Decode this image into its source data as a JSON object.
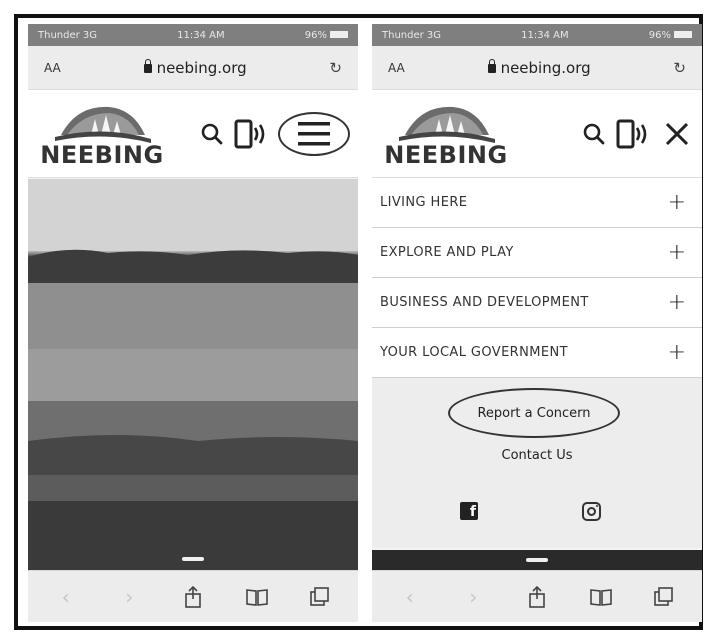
{
  "left_phone": {
    "status": {
      "carrier": "Thunder 3G",
      "time": "11:34 AM",
      "battery": "96%"
    },
    "url_bar": {
      "text_size": "AA",
      "url": "neebing.org",
      "reload_icon": "reload-icon"
    },
    "header": {
      "logo_text": "NEEBING",
      "icons": [
        "search-icon",
        "phone-icon",
        "hamburger-menu-icon"
      ]
    },
    "toolbar": [
      "back-icon",
      "forward-icon",
      "share-icon",
      "bookmarks-icon",
      "tabs-icon"
    ]
  },
  "right_phone": {
    "status": {
      "carrier": "Thunder 3G",
      "time": "11:34 AM",
      "battery": "96%"
    },
    "url_bar": {
      "text_size": "AA",
      "url": "neebing.org",
      "reload_icon": "reload-icon"
    },
    "header": {
      "logo_text": "NEEBING",
      "icons": [
        "search-icon",
        "phone-icon",
        "close-icon"
      ]
    },
    "menu": [
      {
        "label": "LIVING HERE",
        "expand": "+"
      },
      {
        "label": "EXPLORE AND PLAY",
        "expand": "+"
      },
      {
        "label": "BUSINESS AND DEVELOPMENT",
        "expand": "+"
      },
      {
        "label": "YOUR LOCAL GOVERNMENT",
        "expand": "+"
      }
    ],
    "links": {
      "report": "Report a Concern",
      "contact": "Contact Us"
    },
    "social": [
      "facebook-icon",
      "instagram-icon"
    ],
    "toolbar": [
      "back-icon",
      "forward-icon",
      "share-icon",
      "bookmarks-icon",
      "tabs-icon"
    ]
  }
}
